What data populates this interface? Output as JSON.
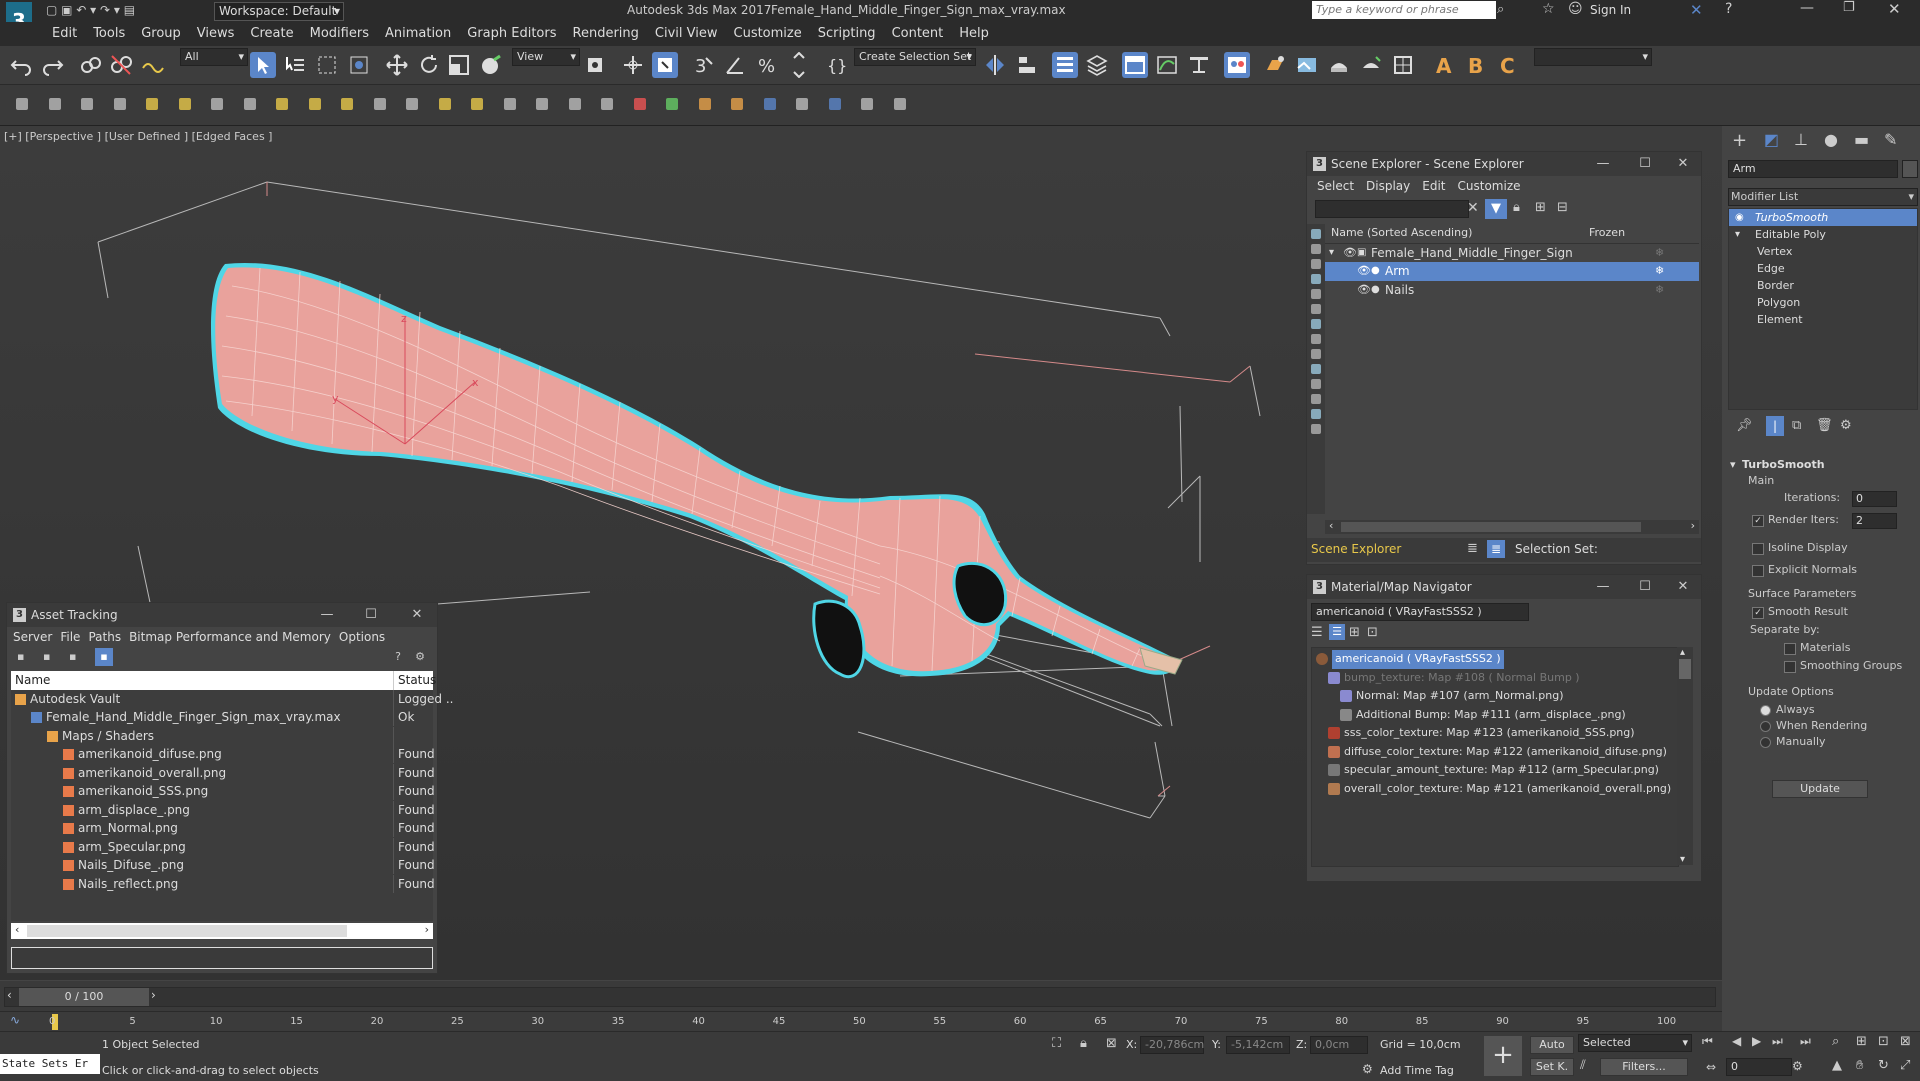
{
  "title_bar": {
    "workspace_label": "Workspace: Default",
    "app_title": "Autodesk 3ds Max 2017",
    "file_title": "Female_Hand_Middle_Finger_Sign_max_vray.max",
    "search_placeholder": "Type a keyword or phrase",
    "sign_in": "Sign In"
  },
  "menu": [
    "Edit",
    "Tools",
    "Group",
    "Views",
    "Create",
    "Modifiers",
    "Animation",
    "Graph Editors",
    "Rendering",
    "Civil View",
    "Customize",
    "Scripting",
    "Content",
    "Help"
  ],
  "toolbar": {
    "filter_value": "All",
    "view_value": "View",
    "selection_set_label": "Create Selection Set"
  },
  "viewport": {
    "labels": "[+] [Perspective ] [User Defined ] [Edged Faces ]",
    "axis_x": "x",
    "axis_y": "y",
    "axis_z": "z"
  },
  "scene_explorer": {
    "title": "Scene Explorer - Scene Explorer",
    "menu": [
      "Select",
      "Display",
      "Edit",
      "Customize"
    ],
    "col_name": "Name (Sorted Ascending)",
    "col_frozen": "Frozen",
    "items": [
      {
        "name": "Female_Hand_Middle_Finger_Sign",
        "level": 0,
        "selected": false
      },
      {
        "name": "Arm",
        "level": 1,
        "selected": true
      },
      {
        "name": "Nails",
        "level": 1,
        "selected": false
      }
    ],
    "footer_name": "Scene Explorer",
    "selection_set": "Selection Set:"
  },
  "material_navigator": {
    "title": "Material/Map Navigator",
    "current": "americanoid  ( VRayFastSSS2 )",
    "items": [
      {
        "text": "americanoid  ( VRayFastSSS2 )",
        "level": 0,
        "selected": true,
        "dim": false,
        "color": "#8a5a3a"
      },
      {
        "text": "bump_texture: Map #108  ( Normal Bump )",
        "level": 1,
        "selected": false,
        "dim": true,
        "color": "#8a8ad0"
      },
      {
        "text": "Normal: Map #107 (arm_Normal.png)",
        "level": 2,
        "selected": false,
        "dim": false,
        "color": "#8a8ad0"
      },
      {
        "text": "Additional Bump: Map #111 (arm_displace_.png)",
        "level": 2,
        "selected": false,
        "dim": false,
        "color": "#888888"
      },
      {
        "text": "sss_color_texture: Map #123 (amerikanoid_SSS.png)",
        "level": 1,
        "selected": false,
        "dim": false,
        "color": "#b04030"
      },
      {
        "text": "diffuse_color_texture: Map #122 (amerikanoid_difuse.png)",
        "level": 1,
        "selected": false,
        "dim": false,
        "color": "#c07050"
      },
      {
        "text": "specular_amount_texture: Map #112 (arm_Specular.png)",
        "level": 1,
        "selected": false,
        "dim": false,
        "color": "#777777"
      },
      {
        "text": "overall_color_texture: Map #121 (amerikanoid_overall.png)",
        "level": 1,
        "selected": false,
        "dim": false,
        "color": "#b07a50"
      }
    ]
  },
  "asset_tracking": {
    "title": "Asset Tracking",
    "menu": [
      "Server",
      "File",
      "Paths",
      "Bitmap Performance and Memory",
      "Options"
    ],
    "col_name": "Name",
    "col_status": "Status",
    "rows": [
      {
        "name": "Autodesk Vault",
        "status": "Logged ..",
        "level": 0,
        "icon": "vault"
      },
      {
        "name": "Female_Hand_Middle_Finger_Sign_max_vray.max",
        "status": "Ok",
        "level": 1,
        "icon": "max"
      },
      {
        "name": "Maps / Shaders",
        "status": "",
        "level": 2,
        "icon": "folder"
      },
      {
        "name": "amerikanoid_difuse.png",
        "status": "Found",
        "level": 3,
        "icon": "image"
      },
      {
        "name": "amerikanoid_overall.png",
        "status": "Found",
        "level": 3,
        "icon": "image"
      },
      {
        "name": "amerikanoid_SSS.png",
        "status": "Found",
        "level": 3,
        "icon": "image"
      },
      {
        "name": "arm_displace_.png",
        "status": "Found",
        "level": 3,
        "icon": "image"
      },
      {
        "name": "arm_Normal.png",
        "status": "Found",
        "level": 3,
        "icon": "image"
      },
      {
        "name": "arm_Specular.png",
        "status": "Found",
        "level": 3,
        "icon": "image"
      },
      {
        "name": "Nails_Difuse_.png",
        "status": "Found",
        "level": 3,
        "icon": "image"
      },
      {
        "name": "Nails_reflect.png",
        "status": "Found",
        "level": 3,
        "icon": "image"
      }
    ]
  },
  "command_panel": {
    "object_name": "Arm",
    "modifier_list_label": "Modifier List",
    "stack": [
      {
        "label": "TurboSmooth",
        "level": 0,
        "selected": true
      },
      {
        "label": "Editable Poly",
        "level": 0,
        "selected": false
      },
      {
        "label": "Vertex",
        "level": 1,
        "selected": false
      },
      {
        "label": "Edge",
        "level": 1,
        "selected": false
      },
      {
        "label": "Border",
        "level": 1,
        "selected": false
      },
      {
        "label": "Polygon",
        "level": 1,
        "selected": false
      },
      {
        "label": "Element",
        "level": 1,
        "selected": false
      }
    ],
    "turbosmooth": {
      "title": "TurboSmooth",
      "main": "Main",
      "iterations_label": "Iterations:",
      "iterations_value": "0",
      "render_iters_label": "Render Iters:",
      "render_iters_value": "2",
      "isoline": "Isoline Display",
      "explicit_normals": "Explicit Normals",
      "surface_params": "Surface Parameters",
      "smooth_result": "Smooth Result",
      "separate_by": "Separate by:",
      "materials": "Materials",
      "smoothing_groups": "Smoothing Groups",
      "update_options": "Update Options",
      "always": "Always",
      "when_rendering": "When Rendering",
      "manually": "Manually",
      "update_button": "Update"
    }
  },
  "timeline": {
    "frame_label": "0 / 100",
    "ticks": [
      "0",
      "5",
      "10",
      "15",
      "20",
      "25",
      "30",
      "35",
      "40",
      "45",
      "50",
      "55",
      "60",
      "65",
      "70",
      "75",
      "80",
      "85",
      "90",
      "95",
      "100"
    ]
  },
  "status_bar": {
    "state_sets": "State Sets Er",
    "selected": "1 Object Selected",
    "prompt": "Click or click-and-drag to select objects",
    "x_label": "X:",
    "x_value": "-20,786cm",
    "y_label": "Y:",
    "y_value": "-5,142cm",
    "z_label": "Z:",
    "z_value": "0,0cm",
    "grid": "Grid = 10,0cm",
    "add_time_tag": "Add Time Tag",
    "auto": "Auto",
    "set_k": "Set K.",
    "selected_dropdown": "Selected",
    "filters": "Filters...",
    "frame_spinner": "0"
  },
  "colors": {
    "selection": "#5b86c9",
    "skin": "#e9a29c",
    "outline": "#4fd6e6",
    "scene_label": "#e8c84a"
  }
}
